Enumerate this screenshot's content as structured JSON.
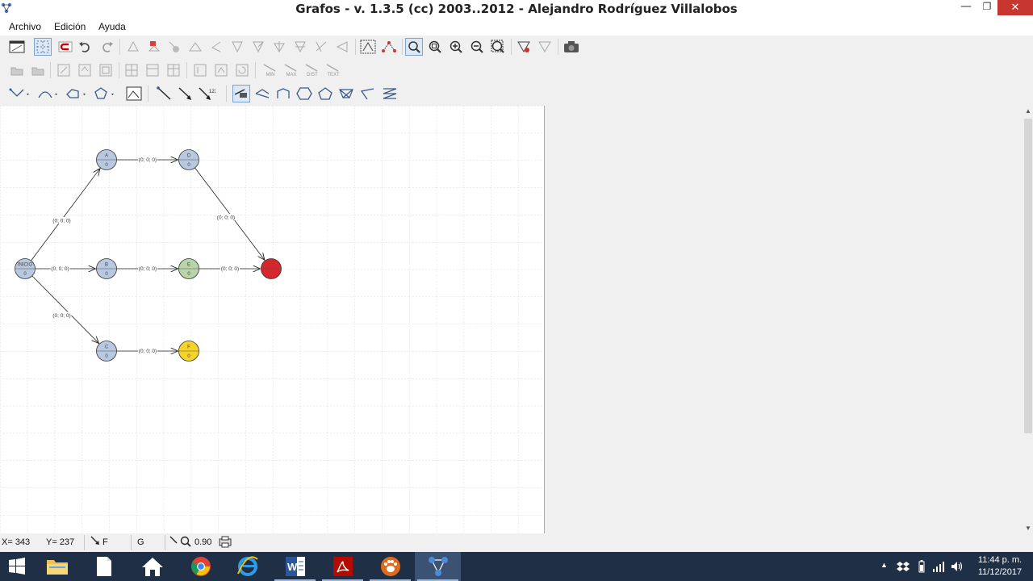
{
  "window": {
    "title": "Grafos - v. 1.3.5  (cc) 2003..2012 - Alejandro Rodríguez Villalobos",
    "min_glyph": "—",
    "max_glyph": "❐",
    "close_glyph": "✕"
  },
  "menu": {
    "archivo": "Archivo",
    "edicion": "Edición",
    "ayuda": "Ayuda"
  },
  "toolbar2": {
    "min": "MIN",
    "max": "MAX",
    "dist": "DIST",
    "text": "TEXT"
  },
  "graph": {
    "nodes": [
      {
        "id": "INICIO",
        "label": "INICIO",
        "value": "0",
        "color": "#b8c8e0"
      },
      {
        "id": "A",
        "label": "A",
        "value": "0",
        "color": "#b8c8e0"
      },
      {
        "id": "B",
        "label": "B",
        "value": "0",
        "color": "#b8c8e0"
      },
      {
        "id": "C",
        "label": "C",
        "value": "0",
        "color": "#b8c8e0"
      },
      {
        "id": "D",
        "label": "D",
        "value": "0",
        "color": "#b8c8e0"
      },
      {
        "id": "E",
        "label": "E",
        "value": "0",
        "color": "#b9d4a8"
      },
      {
        "id": "F",
        "label": "F",
        "value": "0",
        "color": "#f5d327"
      },
      {
        "id": "FIN",
        "label": "",
        "value": "",
        "color": "#d6272c"
      }
    ],
    "edges": [
      {
        "from": "INICIO",
        "to": "A",
        "label": "(0; 0; 0)"
      },
      {
        "from": "INICIO",
        "to": "B",
        "label": "(0; 0; 0)"
      },
      {
        "from": "INICIO",
        "to": "C",
        "label": "(0; 0; 0)"
      },
      {
        "from": "A",
        "to": "D",
        "label": "(0; 0; 0)"
      },
      {
        "from": "B",
        "to": "E",
        "label": "(0; 0; 0)"
      },
      {
        "from": "C",
        "to": "F",
        "label": "(0; 0; 0)"
      },
      {
        "from": "D",
        "to": "FIN",
        "label": "(0; 0; 0)"
      },
      {
        "from": "E",
        "to": "FIN",
        "label": "(0; 0; 0)"
      }
    ]
  },
  "status": {
    "x": "X= 343",
    "y": "Y= 237",
    "tool": "F",
    "mode": "G",
    "zoom": "0.90"
  },
  "clock": {
    "time": "11:44 p. m.",
    "date": "11/12/2017"
  }
}
